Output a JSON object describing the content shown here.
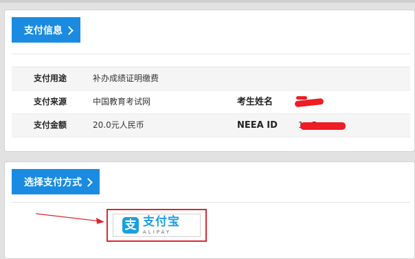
{
  "pay_info": {
    "section_title": "支付信息",
    "rows": [
      {
        "label": "支付用途",
        "value": "补办成绩证明缴费"
      },
      {
        "label": "支付来源",
        "value": "中国教育考试网",
        "label2": "考生姓名",
        "value2": ""
      },
      {
        "label": "支付金额",
        "value": "20.0元人民币",
        "label2": "NEEA ID",
        "value2": "1…5"
      }
    ]
  },
  "pay_method": {
    "section_title": "选择支付方式",
    "alipay": {
      "logo_glyph": "支",
      "name_cn": "支付宝",
      "name_en": "ALIPAY"
    }
  },
  "colors": {
    "accent": "#1a8be1",
    "alipay_blue": "#1a9fe0",
    "highlight_red": "#d8282f",
    "redaction": "#ee1c25"
  },
  "icons": {
    "section_chevron": "chevron-right-icon",
    "annotation_arrow": "red-arrow"
  }
}
